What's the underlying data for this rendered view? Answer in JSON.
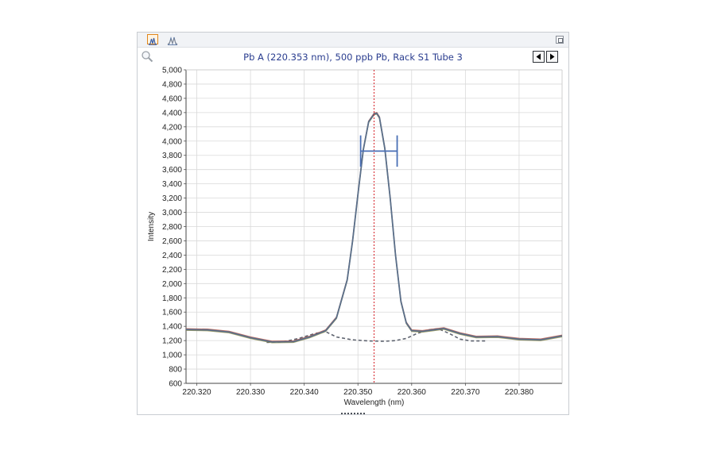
{
  "toolbar": {
    "buttons": [
      {
        "icon": "spectrum-view-icon",
        "active": true
      },
      {
        "icon": "overlay-view-icon",
        "active": false
      }
    ],
    "restore_icon": "restore-window-icon"
  },
  "zoom_icon": "magnifier-icon",
  "navigation": {
    "prev_icon": "triangle-left-icon",
    "next_icon": "triangle-right-icon"
  },
  "colors": {
    "peak_line": "#5a6f8a",
    "peak_overlay_red": "#b34a3a",
    "peak_overlay_olive": "#8f8a3e",
    "background_dashed": "#5f6470",
    "marker": "#d6232a",
    "integration_bar": "#4a6fb5",
    "grid": "#d9d9d9"
  },
  "chart_data": {
    "type": "line",
    "title": "Pb A (220.353 nm), 500 ppb Pb, Rack S1 Tube 3",
    "xlabel": "Wavelength (nm)",
    "ylabel": "Intensity",
    "xlim": [
      220.318,
      220.388
    ],
    "ylim": [
      600,
      5000
    ],
    "x_ticks": [
      "220.320",
      "220.330",
      "220.340",
      "220.350",
      "220.360",
      "220.370",
      "220.380"
    ],
    "x_tick_values": [
      220.32,
      220.33,
      220.34,
      220.35,
      220.36,
      220.37,
      220.38
    ],
    "y_ticks": [
      "5,000",
      "4,800",
      "4,600",
      "4,400",
      "4,200",
      "4,000",
      "3,800",
      "3,600",
      "3,400",
      "3,200",
      "3,000",
      "2,800",
      "2,600",
      "2,400",
      "2,200",
      "2,000",
      "1,800",
      "1,600",
      "1,400",
      "1,200",
      "1,000",
      "800",
      "600"
    ],
    "y_tick_values": [
      5000,
      4800,
      4600,
      4400,
      4200,
      4000,
      3800,
      3600,
      3400,
      3200,
      3000,
      2800,
      2600,
      2400,
      2200,
      2000,
      1800,
      1600,
      1400,
      1200,
      1000,
      800,
      600
    ],
    "grid": true,
    "marker_x": 220.353,
    "integration_window": {
      "x_start": 220.3505,
      "x_end": 220.3573,
      "y": 3860,
      "y_top": 4080,
      "y_bottom": 3640
    },
    "series": [
      {
        "style": "solid",
        "x": [
          220.318,
          220.322,
          220.326,
          220.33,
          220.334,
          220.338,
          220.341,
          220.344,
          220.346,
          220.348,
          220.349,
          220.35,
          220.351,
          220.352,
          220.353,
          220.3535,
          220.354,
          220.355,
          220.356,
          220.357,
          220.358,
          220.359,
          220.36,
          220.362,
          220.364,
          220.366,
          220.369,
          220.372,
          220.376,
          220.38,
          220.384,
          220.388
        ],
        "y": [
          1355,
          1350,
          1320,
          1240,
          1180,
          1185,
          1250,
          1340,
          1520,
          2050,
          2600,
          3250,
          3880,
          4270,
          4380,
          4390,
          4330,
          3900,
          3200,
          2400,
          1750,
          1450,
          1340,
          1330,
          1350,
          1370,
          1300,
          1250,
          1255,
          1220,
          1210,
          1265
        ]
      },
      {
        "style": "dashed",
        "x": [
          220.333,
          220.336,
          220.339,
          220.342,
          220.344,
          220.346,
          220.349,
          220.352,
          220.355,
          220.357,
          220.359,
          220.361,
          220.363,
          220.365,
          220.367,
          220.369,
          220.371,
          220.374
        ],
        "y": [
          1175,
          1180,
          1230,
          1300,
          1325,
          1250,
          1210,
          1195,
          1190,
          1200,
          1230,
          1300,
          1350,
          1365,
          1300,
          1220,
          1195,
          1195
        ]
      }
    ]
  }
}
